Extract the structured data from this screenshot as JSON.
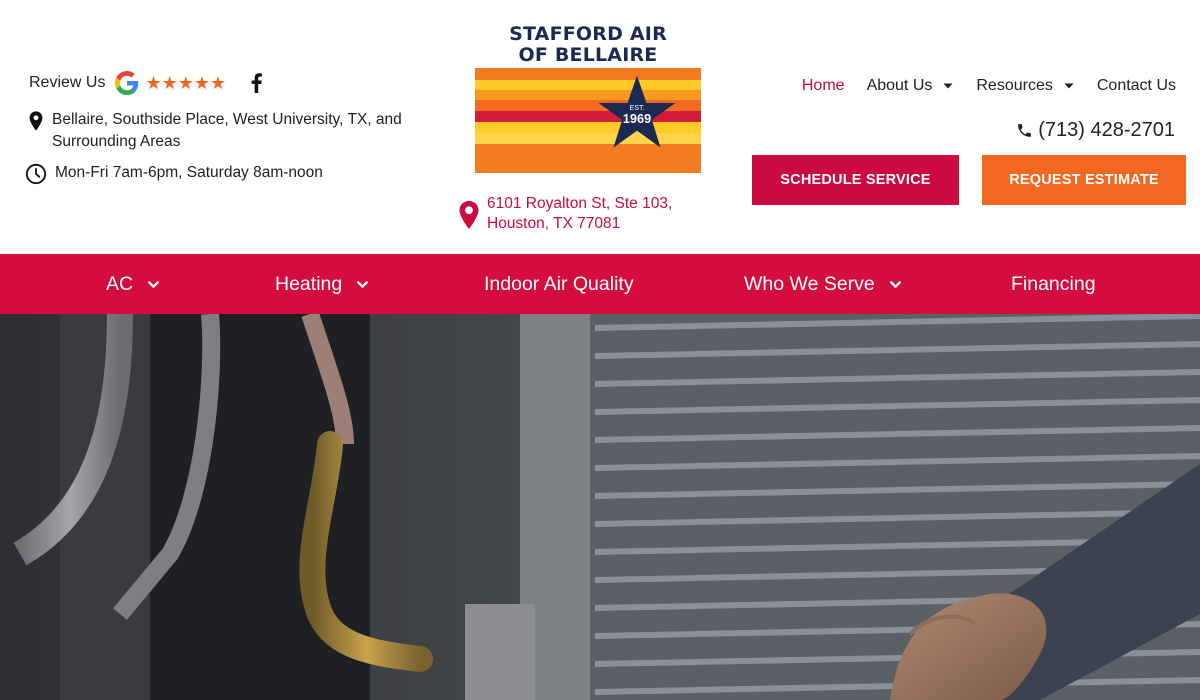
{
  "header": {
    "review_label": "Review Us",
    "stars": "★★★★★",
    "service_area": "Bellaire, Southside Place, West University, TX, and Surrounding Areas",
    "hours": "Mon-Fri 7am-6pm, Saturday 8am-noon",
    "logo": {
      "line1": "STAFFORD AIR",
      "line2": "OF BELLAIRE",
      "est": "EST.",
      "year": "1969"
    },
    "address_line1": "6101 Royalton St, Ste 103,",
    "address_line2": "Houston, TX 77081",
    "phone": "(713) 428-2701",
    "icons": {
      "google": "google-g-icon",
      "facebook": "facebook-icon",
      "location": "map-pin-icon",
      "clock": "clock-icon",
      "phone": "phone-icon"
    }
  },
  "topnav": {
    "home": "Home",
    "about": "About Us",
    "resources": "Resources",
    "contact": "Contact Us"
  },
  "buttons": {
    "schedule": "SCHEDULE SERVICE",
    "estimate": "REQUEST ESTIMATE"
  },
  "mainnav": {
    "ac": "AC",
    "heating": "Heating",
    "iaq": "Indoor Air Quality",
    "who": "Who We Serve",
    "financing": "Financing"
  },
  "colors": {
    "brand_red": "#d50d3f",
    "accent_orange": "#f26722",
    "navy": "#1b2a52",
    "active_link": "#cc0a3f"
  }
}
